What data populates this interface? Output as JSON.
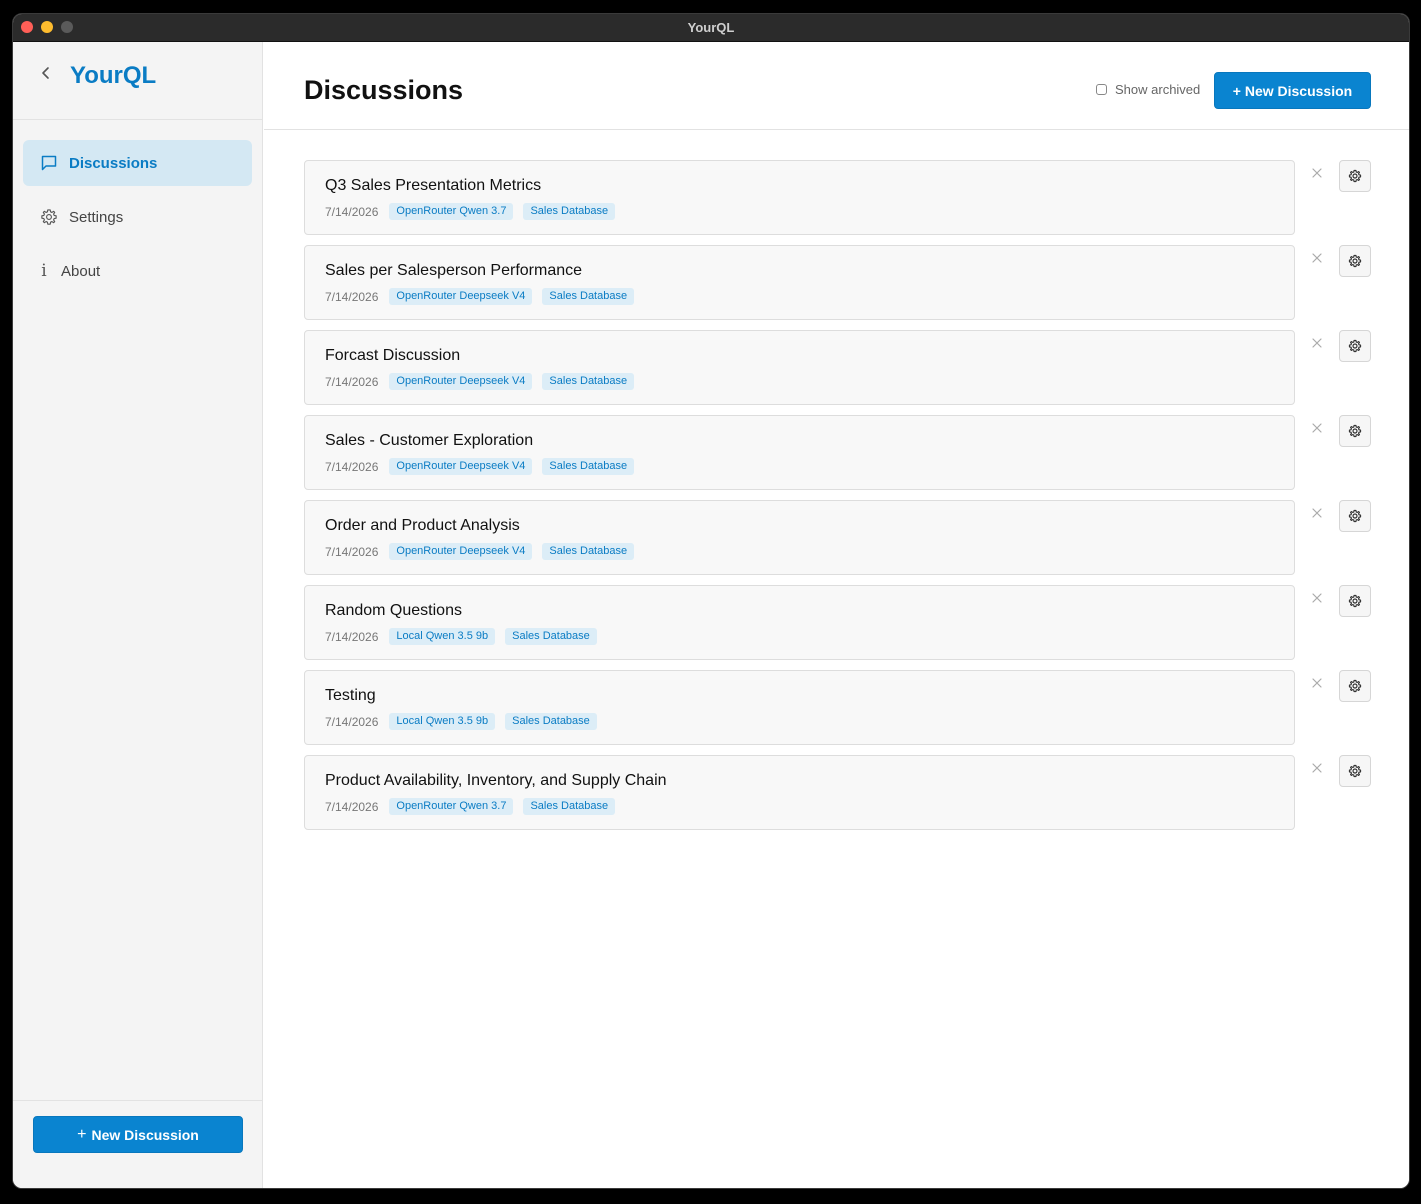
{
  "window": {
    "title": "YourQL"
  },
  "sidebar": {
    "brand": "YourQL",
    "items": [
      {
        "label": "Discussions",
        "icon": "chat-bubble-icon",
        "active": true
      },
      {
        "label": "Settings",
        "icon": "gear-icon",
        "active": false
      },
      {
        "label": "About",
        "icon": "info-icon",
        "active": false
      }
    ],
    "new_button": {
      "plus": "+",
      "label": "New Discussion"
    }
  },
  "header": {
    "title": "Discussions",
    "show_archived_label": "Show archived",
    "show_archived_checked": false,
    "new_button_label": "+ New Discussion"
  },
  "discussions": [
    {
      "title": "Q3 Sales Presentation Metrics",
      "date": "7/14/2026",
      "model": "OpenRouter Qwen 3.7",
      "database": "Sales Database"
    },
    {
      "title": "Sales per Salesperson Performance",
      "date": "7/14/2026",
      "model": "OpenRouter Deepseek V4",
      "database": "Sales Database"
    },
    {
      "title": "Forcast Discussion",
      "date": "7/14/2026",
      "model": "OpenRouter Deepseek V4",
      "database": "Sales Database"
    },
    {
      "title": "Sales - Customer Exploration",
      "date": "7/14/2026",
      "model": "OpenRouter Deepseek V4",
      "database": "Sales Database"
    },
    {
      "title": "Order and Product Analysis",
      "date": "7/14/2026",
      "model": "OpenRouter Deepseek V4",
      "database": "Sales Database"
    },
    {
      "title": "Random Questions",
      "date": "7/14/2026",
      "model": "Local Qwen 3.5 9b",
      "database": "Sales Database"
    },
    {
      "title": "Testing",
      "date": "7/14/2026",
      "model": "Local Qwen 3.5 9b",
      "database": "Sales Database"
    },
    {
      "title": "Product Availability, Inventory, and Supply Chain",
      "date": "7/14/2026",
      "model": "OpenRouter Qwen 3.7",
      "database": "Sales Database"
    }
  ],
  "icons": {
    "close": "close-icon",
    "row_settings": "gear-icon",
    "back": "chevron-left-icon"
  },
  "colors": {
    "accent": "#0a84d0",
    "brand": "#0a7cc4",
    "active_bg": "#d4e8f3",
    "tag_bg": "#dcedf7"
  }
}
